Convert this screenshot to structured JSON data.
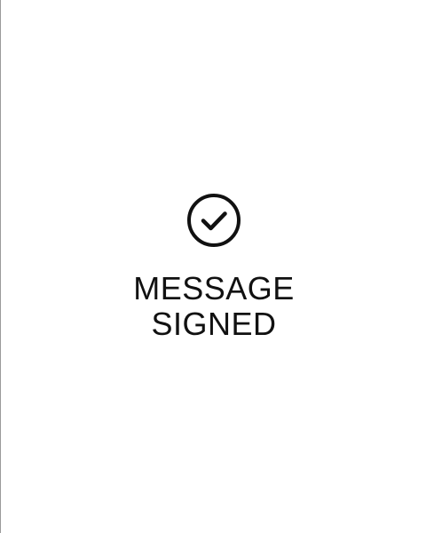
{
  "status": {
    "icon": "check-circle-icon",
    "line1": "MESSAGE",
    "line2": "SIGNED"
  }
}
